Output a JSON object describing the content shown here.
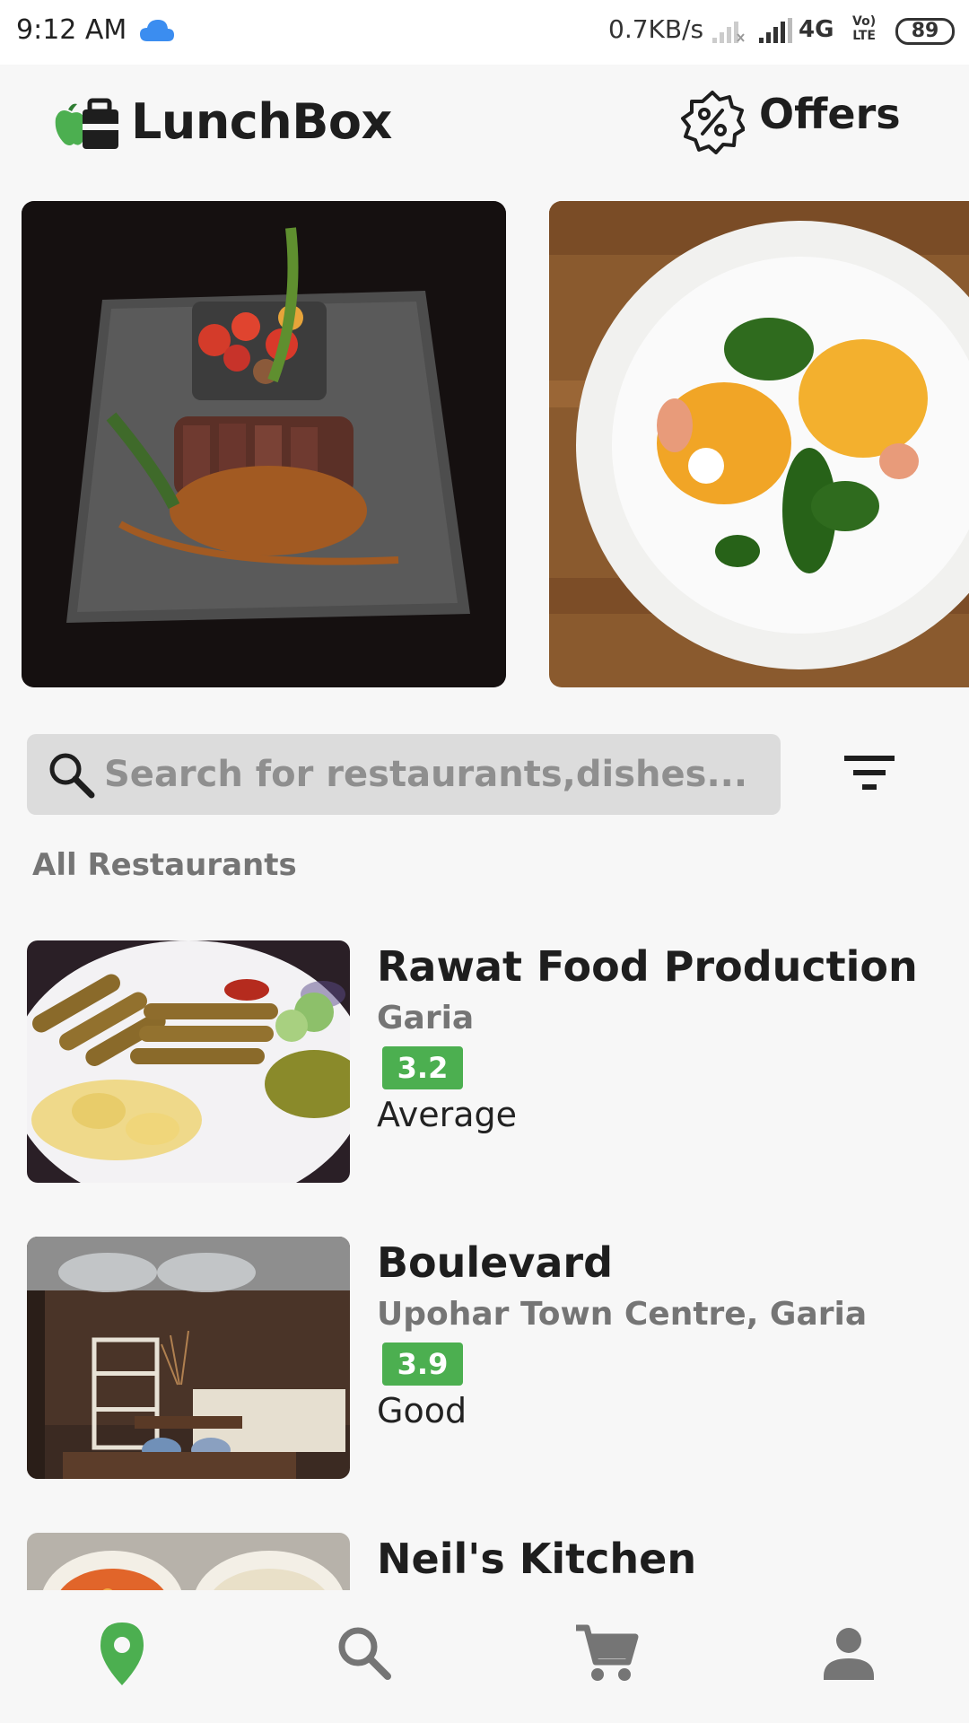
{
  "status_bar": {
    "time": "9:12 AM",
    "net_speed": "0.7KB/s",
    "network": "4G",
    "volte_line1": "Vo)",
    "volte_line2": "LTE",
    "battery": "89"
  },
  "header": {
    "brand": "LunchBox",
    "offers_label": "Offers"
  },
  "search": {
    "placeholder": "Search for restaurants,dishes..."
  },
  "section_title": "All Restaurants",
  "restaurants": [
    {
      "name": "Rawat Food Production",
      "location": "Garia",
      "rating": "3.2",
      "rating_text": "Average"
    },
    {
      "name": "Boulevard",
      "location": "Upohar Town Centre, Garia",
      "rating": "3.9",
      "rating_text": "Good"
    },
    {
      "name": "Neil's Kitchen",
      "location": "",
      "rating": "",
      "rating_text": ""
    }
  ],
  "colors": {
    "accent_green": "#4caf50",
    "text_dark": "#1e1e1e",
    "text_muted": "#757575"
  },
  "bottom_nav": [
    {
      "icon": "location-pin-icon",
      "active": true
    },
    {
      "icon": "search-icon",
      "active": false
    },
    {
      "icon": "cart-icon",
      "active": false
    },
    {
      "icon": "profile-icon",
      "active": false
    }
  ]
}
